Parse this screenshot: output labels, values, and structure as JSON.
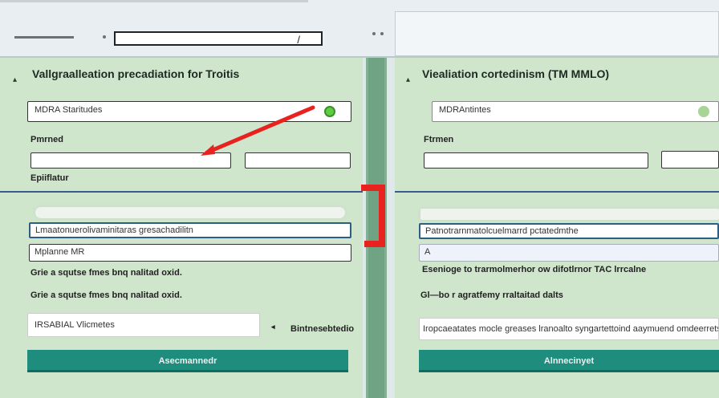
{
  "topbar": {
    "address_cursor": "/"
  },
  "left_panel": {
    "title": "Vallgraalleation precadiation for Troitis",
    "top_field_value": "MDRA Staritudes",
    "label_1": "Pmrned",
    "label_2": "Epiiflatur",
    "wide_field_1": "Lmaatonuerolivaminitaras gresachadilitn",
    "wide_field_2": "Mplanne MR",
    "sentence": "Grie a squtse fmes bnq nalitad oxid.",
    "input_value": "IRSABIAL Vlicmetes",
    "side_text_1": "Bintnes",
    "side_text_2": "ebtedio",
    "button_label": "Asecmannedr"
  },
  "right_panel": {
    "title": "Viealiation cortedinism (TM MMLO)",
    "top_field_value": "MDRAntintes",
    "label_1": "Ftrmen",
    "wide_field_1": "Patnotrarnmatolcuelmarrd pctatedmthe",
    "wide_field_2": "A",
    "sentence_1": "Esenioge to trarmolmerhor ow difotlrnor TAC lrrcalne",
    "sentence_2": "Gl—bo  r agratfemy rraltaitad dalts",
    "long_line": "Iropcaeatates mocle greases lranoalto syngartettoind aaymuend omdeerretsi",
    "button_label": "Alnnecinyet"
  },
  "colors": {
    "panel_bg": "#cfe6cc",
    "button": "#1e8d7e",
    "annotation_red": "#e8231f",
    "indicator_green": "#5fcc43"
  }
}
